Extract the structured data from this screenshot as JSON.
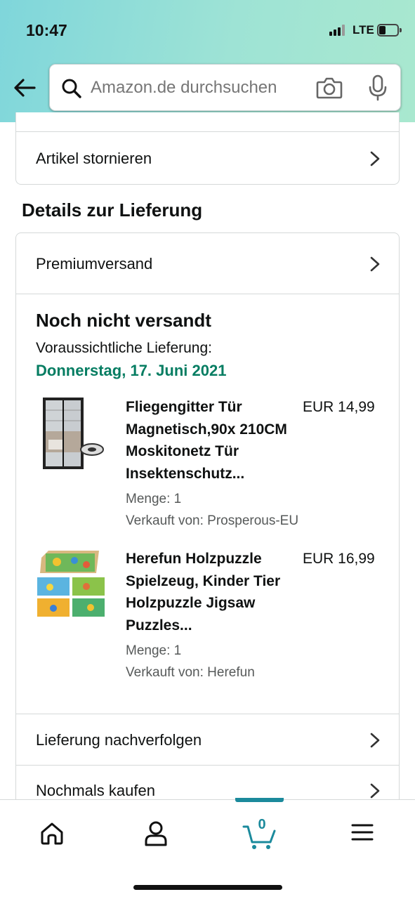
{
  "status_bar": {
    "time": "10:47",
    "network": "LTE"
  },
  "search": {
    "placeholder": "Amazon.de durchsuchen"
  },
  "top_card": {
    "cancel_label": "Artikel stornieren"
  },
  "delivery": {
    "section_title": "Details zur Lieferung",
    "shipping_method": "Premiumversand",
    "status": "Noch nicht versandt",
    "expected_label": "Voraussichtliche Lieferung:",
    "expected_date": "Donnerstag, 17. Juni 2021",
    "date_color": "#067d62",
    "items": [
      {
        "title": "Fliegengitter Tür Magnetisch,90x 210CM Moskitonetz Tür Insektenschutz...",
        "price": "EUR 14,99",
        "quantity": "Menge: 1",
        "seller": "Verkauft von: Prosperous-EU"
      },
      {
        "title": "Herefun Holzpuzzle Spielzeug, Kinder Tier Holzpuzzle Jigsaw Puzzles...",
        "price": "EUR 16,99",
        "quantity": "Menge: 1",
        "seller": "Verkauft von: Herefun"
      }
    ],
    "track_label": "Lieferung nachverfolgen",
    "buy_again_label": "Nochmals kaufen"
  },
  "bottom_nav": {
    "items": [
      "home-icon",
      "account-icon",
      "cart-icon",
      "menu-icon"
    ],
    "cart_count": "0",
    "accent_color": "#1b8a9c"
  }
}
